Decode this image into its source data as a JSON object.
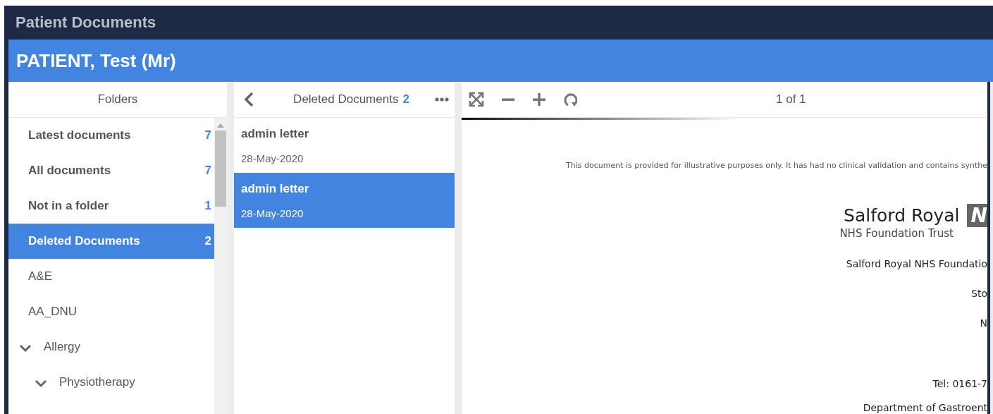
{
  "window": {
    "title": "Patient Documents"
  },
  "patient": {
    "name": "PATIENT, Test (Mr)"
  },
  "folders": {
    "title": "Folders",
    "items": [
      {
        "label": "Latest documents",
        "count": "7",
        "bold": true,
        "selected": false
      },
      {
        "label": "All documents",
        "count": "7",
        "bold": true,
        "selected": false
      },
      {
        "label": "Not in a folder",
        "count": "1",
        "bold": true,
        "selected": false
      },
      {
        "label": "Deleted Documents",
        "count": "2",
        "bold": true,
        "selected": true
      },
      {
        "label": "A&E",
        "bold": false,
        "selected": false
      },
      {
        "label": "AA_DNU",
        "bold": false,
        "selected": false
      },
      {
        "label": "Allergy",
        "bold": false,
        "selected": false,
        "expanded": true,
        "children": [
          {
            "label": "Physiotherapy",
            "bold": false,
            "selected": false,
            "expanded": true
          }
        ]
      }
    ]
  },
  "documents": {
    "title": "Deleted Documents",
    "count": "2",
    "items": [
      {
        "title": "admin letter",
        "date": "28-May-2020",
        "selected": false
      },
      {
        "title": "admin letter",
        "date": "28-May-2020",
        "selected": true
      }
    ]
  },
  "viewer": {
    "page_indicator": "1 of 1",
    "document": {
      "disclaimer": "This document is provided for illustrative purposes only. It has had no clinical validation and contains synthe",
      "org_name": "Salford Royal",
      "logo_text": "N",
      "org_subtitle": "NHS Foundation Trust",
      "address_lines": [
        "Salford Royal NHS Foundatio",
        "Sto",
        "N"
      ],
      "tel": "Tel:  0161-7",
      "department": "Department of Gastroent"
    }
  }
}
